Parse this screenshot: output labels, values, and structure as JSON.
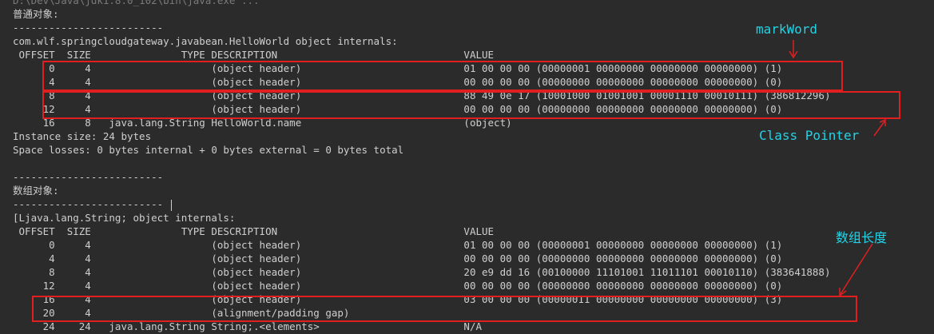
{
  "console": {
    "lines": [
      "D:\\Dev\\Java\\jdk1.8.0_102\\bin\\java.exe ...",
      "普通对象:",
      "-------------------------",
      "com.wlf.springcloudgateway.javabean.HelloWorld object internals:",
      " OFFSET  SIZE               TYPE DESCRIPTION                               VALUE",
      "      0     4                    (object header)                           01 00 00 00 (00000001 00000000 00000000 00000000) (1)",
      "      4     4                    (object header)                           00 00 00 00 (00000000 00000000 00000000 00000000) (0)",
      "      8     4                    (object header)                           88 49 0e 17 (10001000 01001001 00001110 00010111) (386812296)",
      "     12     4                    (object header)                           00 00 00 00 (00000000 00000000 00000000 00000000) (0)",
      "     16     8   java.lang.String HelloWorld.name                           (object)",
      "Instance size: 24 bytes",
      "Space losses: 0 bytes internal + 0 bytes external = 0 bytes total",
      "",
      "-------------------------",
      "数组对象:",
      "-------------------------",
      "[Ljava.lang.String; object internals:",
      " OFFSET  SIZE               TYPE DESCRIPTION                               VALUE",
      "      0     4                    (object header)                           01 00 00 00 (00000001 00000000 00000000 00000000) (1)",
      "      4     4                    (object header)                           00 00 00 00 (00000000 00000000 00000000 00000000) (0)",
      "      8     4                    (object header)                           20 e9 dd 16 (00100000 11101001 11011101 00010110) (383641888)",
      "     12     4                    (object header)                           00 00 00 00 (00000000 00000000 00000000 00000000) (0)",
      "     16     4                    (object header)                           03 00 00 00 (00000011 00000000 00000000 00000000) (3)",
      "     20     4                    (alignment/padding gap)",
      "     24    24   java.lang.String String;.<elements>                        N/A"
    ]
  },
  "annotations": {
    "markword": "markWord",
    "class_pointer": "Class Pointer",
    "array_length": "数组长度"
  },
  "colors": {
    "background": "#2b2b2b",
    "text": "#cfcfcf",
    "highlight_box": "#e02020",
    "annotation": "#22d3e6"
  }
}
